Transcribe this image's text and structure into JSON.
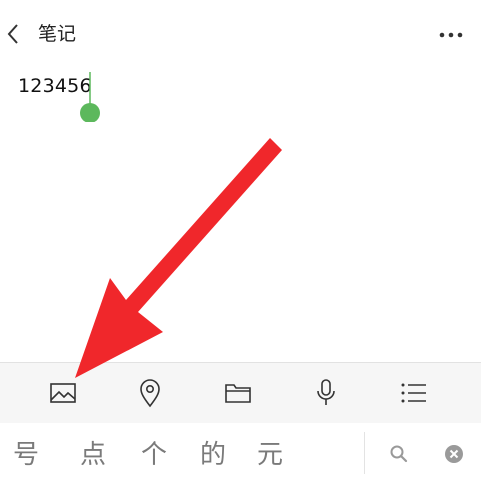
{
  "header": {
    "title": "笔记",
    "back_icon": "chevron-left-icon",
    "more_icon": "more-dots-icon"
  },
  "note": {
    "content": "123456"
  },
  "annotation": {
    "arrow_color": "#f0272b",
    "cursor_color": "#5cb85c"
  },
  "toolbar": {
    "items": [
      {
        "icon": "image-icon"
      },
      {
        "icon": "location-pin-icon"
      },
      {
        "icon": "folder-icon"
      },
      {
        "icon": "microphone-icon"
      },
      {
        "icon": "list-icon"
      }
    ]
  },
  "suggestions": {
    "candidates": [
      "号",
      "点",
      "个",
      "的",
      "元"
    ],
    "search_icon": "search-icon",
    "clear_icon": "clear-circle-icon"
  }
}
